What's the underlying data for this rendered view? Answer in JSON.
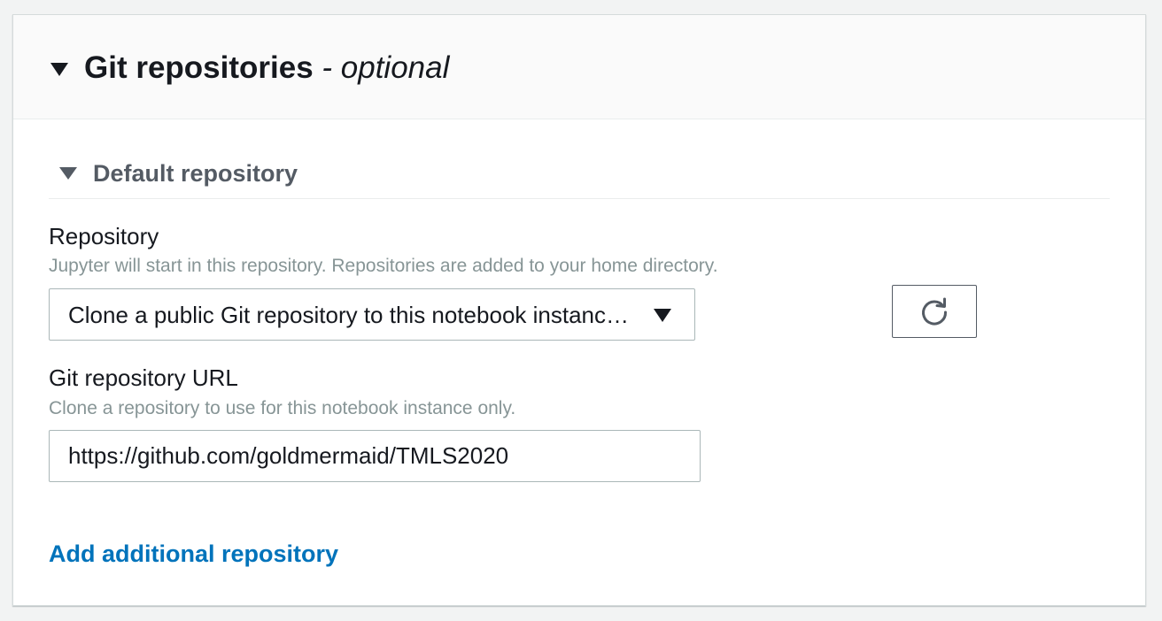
{
  "section": {
    "title": "Git repositories",
    "optional_suffix": " - optional",
    "caret_icon": "caret-down-icon"
  },
  "default_repository": {
    "title": "Default repository",
    "caret_icon": "caret-down-icon"
  },
  "repository_field": {
    "label": "Repository",
    "description": "Jupyter will start in this repository. Repositories are added to your home directory.",
    "selected_value": "Clone a public Git repository to this notebook instance only",
    "dropdown_icon": "caret-down-icon",
    "refresh_icon": "refresh-icon"
  },
  "url_field": {
    "label": "Git repository URL",
    "description": "Clone a repository to use for this notebook instance only.",
    "value": "https://github.com/goldmermaid/TMLS2020"
  },
  "add_link": {
    "label": "Add additional repository"
  },
  "colors": {
    "link": "#0073bb",
    "text": "#16191f",
    "muted": "#879596",
    "header_bg": "#fafafa",
    "page_bg": "#f2f3f3"
  }
}
